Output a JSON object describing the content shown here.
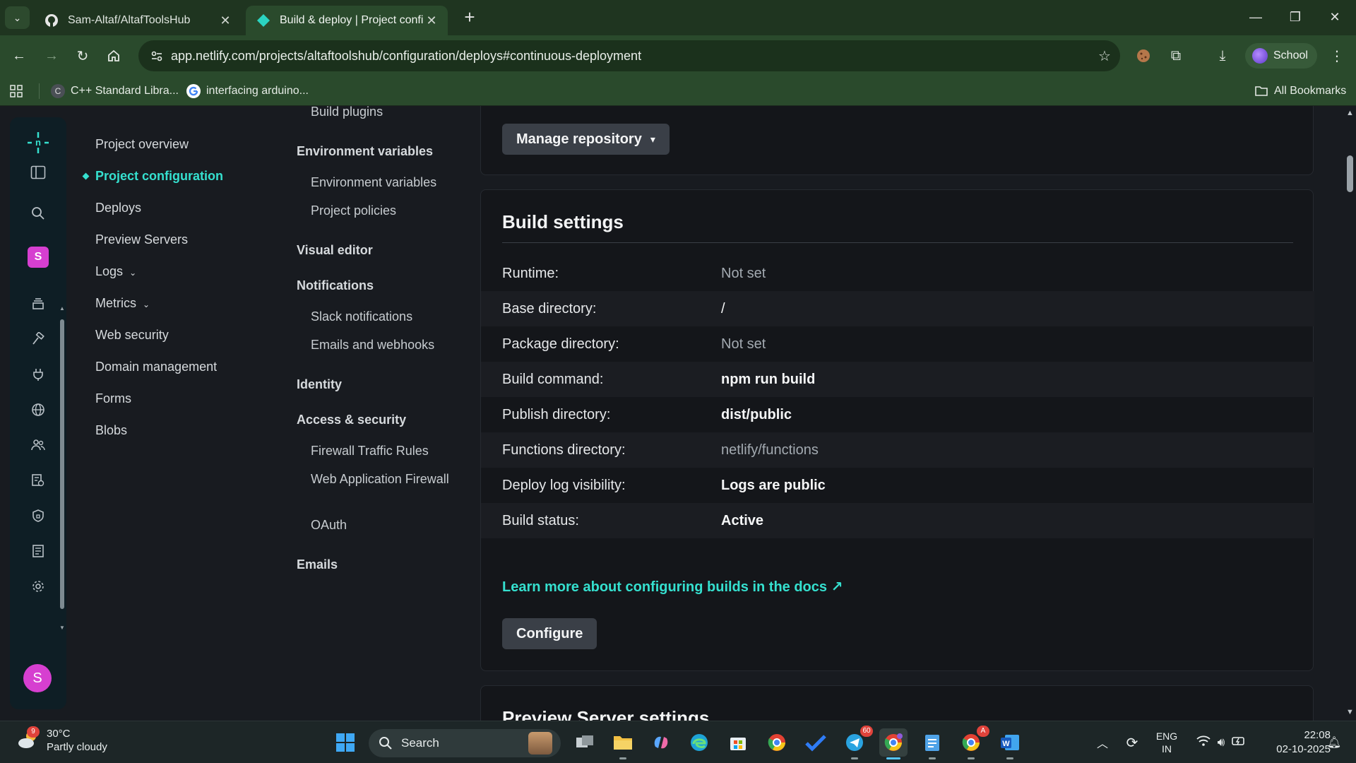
{
  "browser": {
    "tabs": [
      {
        "title": "Sam-Altaf/AltafToolsHub",
        "favicon": "github-icon"
      },
      {
        "title": "Build & deploy | Project configu",
        "favicon": "netlify-icon"
      }
    ],
    "url": "app.netlify.com/projects/altaftoolshub/configuration/deploys#continuous-deployment",
    "profile_label": "School",
    "bookmarks": [
      {
        "label": "C++ Standard Libra...",
        "icon": "cpp-reference-icon"
      },
      {
        "label": "interfacing arduino...",
        "icon": "google-icon"
      }
    ],
    "all_bookmarks_label": "All Bookmarks"
  },
  "rail": {
    "avatar_letter": "S",
    "team_letter": "S"
  },
  "site_nav": [
    {
      "label": "Project overview"
    },
    {
      "label": "Project configuration",
      "active": true
    },
    {
      "label": "Deploys"
    },
    {
      "label": "Preview Servers"
    },
    {
      "label": "Logs",
      "chevron": true
    },
    {
      "label": "Metrics",
      "chevron": true
    },
    {
      "label": "Web security"
    },
    {
      "label": "Domain management"
    },
    {
      "label": "Forms"
    },
    {
      "label": "Blobs"
    }
  ],
  "sub_nav": {
    "build_plugins": "Build plugins",
    "environment_variables_head": "Environment variables",
    "environment_variables_link": "Environment variables",
    "project_policies": "Project policies",
    "visual_editor": "Visual editor",
    "notifications": "Notifications",
    "slack_notifications": "Slack notifications",
    "emails_and_webhooks": "Emails and webhooks",
    "identity": "Identity",
    "access_security": "Access & security",
    "firewall_traffic_rules": "Firewall Traffic Rules",
    "web_application_firewall": "Web Application Firewall",
    "oauth": "OAuth",
    "emails": "Emails"
  },
  "repo_card": {
    "manage_repository_label": "Manage repository"
  },
  "build_settings": {
    "title": "Build settings",
    "rows": [
      {
        "label": "Runtime:",
        "value": "Not set",
        "style": "muted"
      },
      {
        "label": "Base directory:",
        "value": "/",
        "style": "normal"
      },
      {
        "label": "Package directory:",
        "value": "Not set",
        "style": "muted"
      },
      {
        "label": "Build command:",
        "value": "npm run build",
        "style": "strong"
      },
      {
        "label": "Publish directory:",
        "value": "dist/public",
        "style": "strong"
      },
      {
        "label": "Functions directory:",
        "value": "netlify/functions",
        "style": "muted"
      },
      {
        "label": "Deploy log visibility:",
        "value": "Logs are public",
        "style": "strong"
      },
      {
        "label": "Build status:",
        "value": "Active",
        "style": "strong"
      }
    ],
    "docs_link": "Learn more about configuring builds in the docs ↗",
    "configure_label": "Configure"
  },
  "next_section": {
    "title": "Preview Server settings"
  },
  "taskbar": {
    "weather_temp": "30°C",
    "weather_desc": "Partly cloudy",
    "weather_badge": "9",
    "search_placeholder": "Search",
    "telegram_badge": "60",
    "chrome_alt_badge": "A",
    "lang_line1": "ENG",
    "lang_line2": "IN",
    "time": "22:08",
    "date": "02-10-2025"
  },
  "colors": {
    "accent": "#35e0cf",
    "background": "#181b20",
    "card": "#14161a",
    "browser_chrome": "#2a4a2c"
  }
}
